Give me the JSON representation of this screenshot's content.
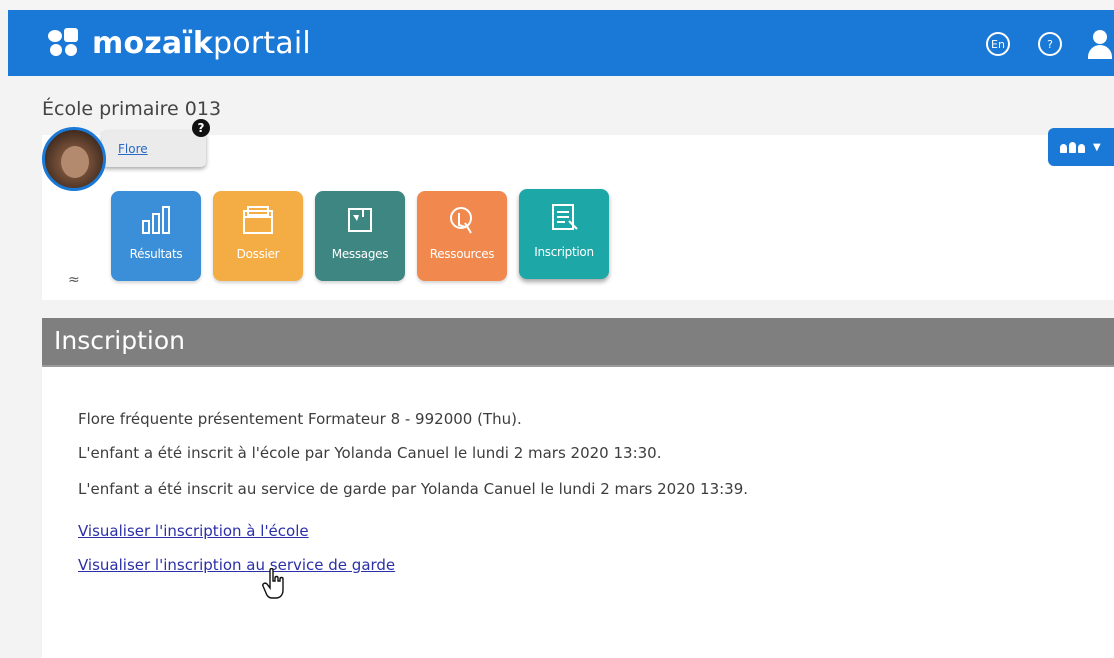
{
  "header": {
    "logo_bold": "mozaïk",
    "logo_light": "portail",
    "lang_label": "En",
    "help_label": "?"
  },
  "school": {
    "name": "École primaire 013"
  },
  "student": {
    "name": "Flore",
    "badge": "?"
  },
  "tiles": [
    {
      "label": "Résultats",
      "icon": "bar-chart-icon",
      "color": "#3b8ed8"
    },
    {
      "label": "Dossier",
      "icon": "folder-icon",
      "color": "#f4ad45"
    },
    {
      "label": "Messages",
      "icon": "message-icon",
      "color": "#3e8681"
    },
    {
      "label": "Ressources",
      "icon": "resources-icon",
      "color": "#f1894f"
    },
    {
      "label": "Inscription",
      "icon": "form-icon",
      "color": "#1da7a7"
    }
  ],
  "collapse_glyph": "≈",
  "section": {
    "title": "Inscription",
    "lines": [
      "Flore fréquente présentement Formateur 8 - 992000 (Thu).",
      "L'enfant a été inscrit à l'école par Yolanda Canuel le lundi 2 mars 2020 13:30.",
      "L'enfant a été inscrit au service de garde par Yolanda Canuel le lundi 2 mars 2020 13:39."
    ],
    "links": [
      "Visualiser l'inscription à l'école",
      "Visualiser l'inscription au service de garde"
    ]
  },
  "colors": {
    "brand": "#1a78d6",
    "section_header": "#7f7f7f",
    "link": "#2b2fa8"
  }
}
